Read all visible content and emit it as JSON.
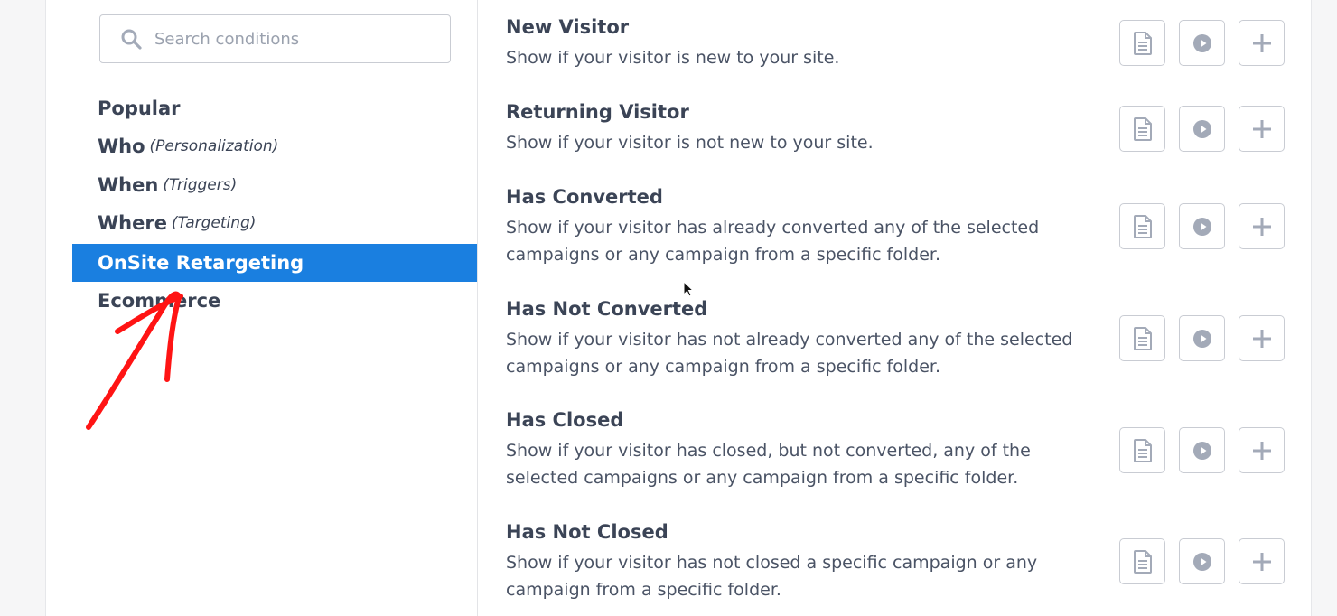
{
  "search": {
    "placeholder": "Search conditions",
    "value": ""
  },
  "categories": [
    {
      "label": "Popular",
      "sub": ""
    },
    {
      "label": "Who",
      "sub": "(Personalization)"
    },
    {
      "label": "When",
      "sub": "(Triggers)"
    },
    {
      "label": "Where",
      "sub": "(Targeting)"
    },
    {
      "label": "OnSite Retargeting",
      "sub": "",
      "active": true
    },
    {
      "label": "Ecommerce",
      "sub": ""
    }
  ],
  "conditions": [
    {
      "title": "New Visitor",
      "description": "Show if your visitor is new to your site."
    },
    {
      "title": "Returning Visitor",
      "description": "Show if your visitor is not new to your site."
    },
    {
      "title": "Has Converted",
      "description": "Show if your visitor has already converted any of the selected campaigns or any campaign from a specific folder."
    },
    {
      "title": "Has Not Converted",
      "description": "Show if your visitor has not already converted any of the selected campaigns or any campaign from a specific folder."
    },
    {
      "title": "Has Closed",
      "description": "Show if your visitor has closed, but not converted, any of the selected campaigns or any campaign from a specific folder."
    },
    {
      "title": "Has Not Closed",
      "description": "Show if your visitor has not closed a specific campaign or any campaign from a specific folder."
    }
  ],
  "action_icons": [
    "document-icon",
    "play-icon",
    "plus-icon"
  ],
  "colors": {
    "accent": "#1a7fe0",
    "annotation": "#ff1414",
    "icon": "#a3aab8"
  }
}
